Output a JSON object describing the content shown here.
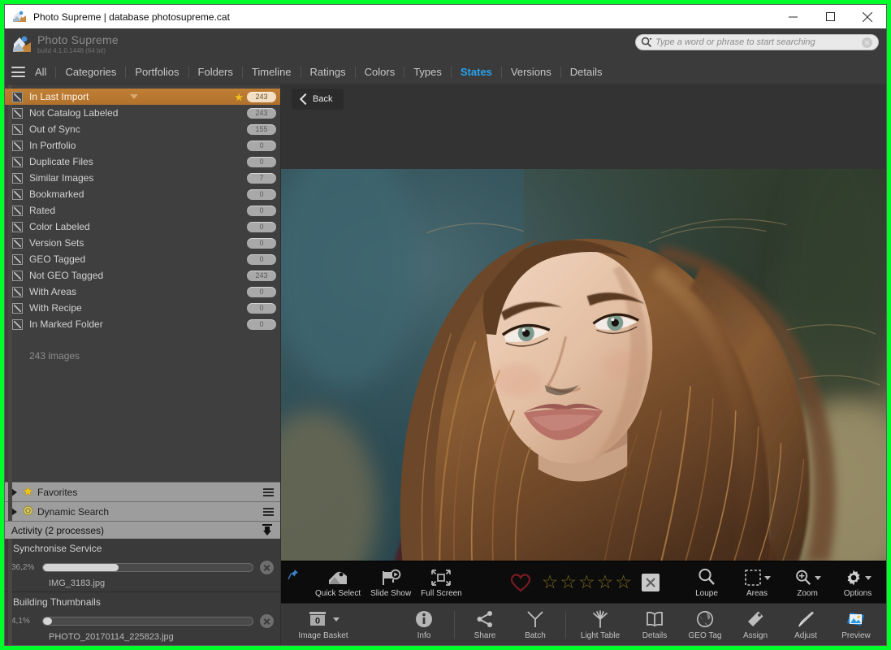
{
  "window": {
    "title": "Photo Supreme | database photosupreme.cat",
    "app_icon": "photo-supreme-logo-icon",
    "minimize": "minimize-icon",
    "maximize": "maximize-icon",
    "close": "close-icon"
  },
  "header": {
    "app_name": "Photo Supreme",
    "build": "build 4.1.0.1448 (64 bit)",
    "search": {
      "placeholder": "Type a word or phrase to start searching",
      "value": "",
      "icon": "search-icon",
      "clear": "clear-icon"
    }
  },
  "nav": {
    "menu_icon": "hamburger-menu-icon",
    "tabs": [
      {
        "label": "All",
        "active": false
      },
      {
        "label": "Categories",
        "active": false
      },
      {
        "label": "Portfolios",
        "active": false
      },
      {
        "label": "Folders",
        "active": false
      },
      {
        "label": "Timeline",
        "active": false
      },
      {
        "label": "Ratings",
        "active": false
      },
      {
        "label": "Colors",
        "active": false
      },
      {
        "label": "Types",
        "active": false
      },
      {
        "label": "States",
        "active": true
      },
      {
        "label": "Versions",
        "active": false
      },
      {
        "label": "Details",
        "active": false
      }
    ],
    "active_color": "#2aa3f0"
  },
  "sidebar": {
    "states": [
      {
        "label": "In Last Import",
        "count": "243",
        "selected": true,
        "starred": true
      },
      {
        "label": "Not Catalog Labeled",
        "count": "243",
        "selected": false,
        "starred": false
      },
      {
        "label": "Out of Sync",
        "count": "155",
        "selected": false,
        "starred": false
      },
      {
        "label": "In Portfolio",
        "count": "0",
        "selected": false,
        "starred": false
      },
      {
        "label": "Duplicate Files",
        "count": "0",
        "selected": false,
        "starred": false
      },
      {
        "label": "Similar Images",
        "count": "7",
        "selected": false,
        "starred": false
      },
      {
        "label": "Bookmarked",
        "count": "0",
        "selected": false,
        "starred": false
      },
      {
        "label": "Rated",
        "count": "0",
        "selected": false,
        "starred": false
      },
      {
        "label": "Color Labeled",
        "count": "0",
        "selected": false,
        "starred": false
      },
      {
        "label": "Version Sets",
        "count": "0",
        "selected": false,
        "starred": false
      },
      {
        "label": "GEO Tagged",
        "count": "0",
        "selected": false,
        "starred": false
      },
      {
        "label": "Not GEO Tagged",
        "count": "243",
        "selected": false,
        "starred": false
      },
      {
        "label": "With Areas",
        "count": "0",
        "selected": false,
        "starred": false
      },
      {
        "label": "With Recipe",
        "count": "0",
        "selected": false,
        "starred": false
      },
      {
        "label": "In Marked Folder",
        "count": "0",
        "selected": false,
        "starred": false
      }
    ],
    "image_count": "243 images",
    "selected_highlight_color": "#b9752e",
    "sections": [
      {
        "label": "Favorites",
        "icon": "star-icon"
      },
      {
        "label": "Dynamic Search",
        "icon": "search-circle-icon"
      }
    ],
    "activity": {
      "header": "Activity (2 processes)",
      "collapse_icon": "collapse-down-icon",
      "processes": [
        {
          "title": "Synchronise Service",
          "percent_label": "36,2%",
          "percent": 36.2,
          "file": "IMG_3183.jpg",
          "cancel": "cancel-icon"
        },
        {
          "title": "Building Thumbnails",
          "percent_label": "4,1%",
          "percent": 4.1,
          "file": "PHOTO_20170114_225823.jpg",
          "cancel": "cancel-icon"
        }
      ]
    }
  },
  "main": {
    "back_button": {
      "label": "Back",
      "icon": "chevron-left-icon"
    },
    "photo_alt": "portrait-photo-of-woman-with-long-brown-hair"
  },
  "toolbar_top": {
    "pin_icon": "pin-icon",
    "items": [
      {
        "label": "Quick Select",
        "icon": "quick-select-icon"
      },
      {
        "label": "Slide Show",
        "icon": "slide-show-icon"
      },
      {
        "label": "Full Screen",
        "icon": "full-screen-icon"
      }
    ],
    "heart_icon": "heart-icon",
    "stars": 5,
    "star_color": "#7d6a1d",
    "clear_rating_icon": "clear-rating-icon",
    "right_items": [
      {
        "label": "Loupe",
        "icon": "magnifier-icon",
        "caret": false
      },
      {
        "label": "Areas",
        "icon": "areas-icon",
        "caret": true
      },
      {
        "label": "Zoom",
        "icon": "zoom-icon",
        "caret": true
      },
      {
        "label": "Options",
        "icon": "gear-icon",
        "caret": true
      }
    ]
  },
  "toolbar_bottom": {
    "basket": {
      "label": "Image Basket",
      "count": "0",
      "icon": "basket-icon",
      "caret": true
    },
    "items": [
      {
        "label": "Info",
        "icon": "info-icon"
      },
      {
        "label": "Share",
        "icon": "share-icon"
      },
      {
        "label": "Batch",
        "icon": "batch-icon"
      },
      {
        "label": "Light Table",
        "icon": "light-table-icon"
      },
      {
        "label": "Details",
        "icon": "details-book-icon"
      },
      {
        "label": "GEO Tag",
        "icon": "globe-icon"
      },
      {
        "label": "Assign",
        "icon": "tag-icon"
      },
      {
        "label": "Adjust",
        "icon": "brush-icon"
      },
      {
        "label": "Preview",
        "icon": "preview-icon"
      }
    ]
  }
}
